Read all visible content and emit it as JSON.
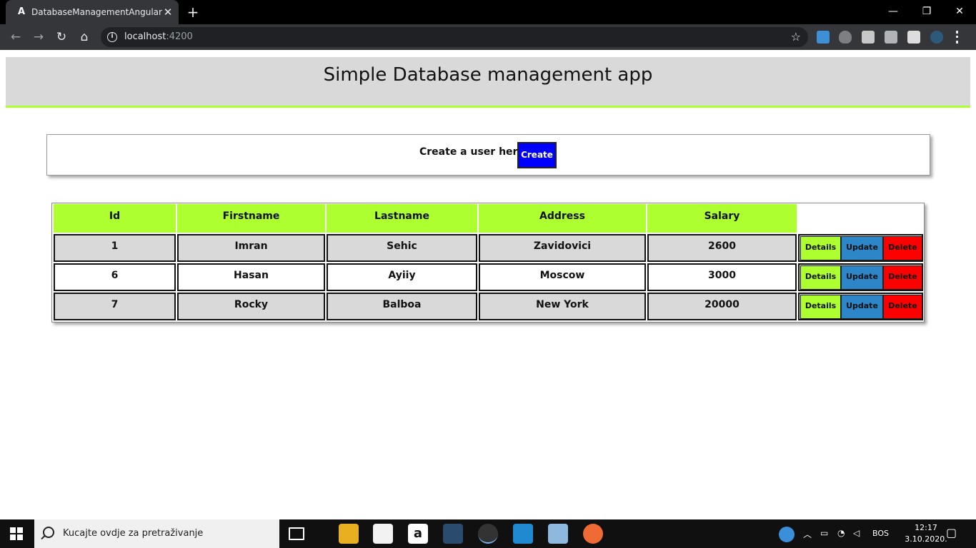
{
  "browser": {
    "tab_title": "DatabaseManagementAngular",
    "tab_icon": "A",
    "close_glyph": "✕",
    "newtab_glyph": "+",
    "url_host": "localhost",
    "url_port": ":4200",
    "window_controls": {
      "minimize": "—",
      "restore": "❐",
      "close": "✕"
    },
    "nav": {
      "back": "←",
      "forward": "→",
      "reload": "↻",
      "home": "⌂"
    },
    "star": "☆"
  },
  "page": {
    "title": "Simple Database management app",
    "create_prompt": "Create a user here!",
    "create_button": "Create"
  },
  "table": {
    "headers": [
      "Id",
      "Firstname",
      "Lastname",
      "Address",
      "Salary"
    ],
    "rows": [
      {
        "id": "1",
        "firstname": "Imran",
        "lastname": "Sehic",
        "address": "Zavidovici",
        "salary": "2600"
      },
      {
        "id": "6",
        "firstname": "Hasan",
        "lastname": "Ayiiy",
        "address": "Moscow",
        "salary": "3000"
      },
      {
        "id": "7",
        "firstname": "Rocky",
        "lastname": "Balboa",
        "address": "New York",
        "salary": "20000"
      }
    ],
    "actions": {
      "details": "Details",
      "update": "Update",
      "delete": "Delete"
    }
  },
  "taskbar": {
    "search_placeholder": "Kucajte ovdje za pretraživanje",
    "language": "BOS",
    "time": "12:17",
    "date": "3.10.2020."
  },
  "colors": {
    "header_bg": "#d9d9d9",
    "accent_green": "#adff2f",
    "create_blue": "#0000ff",
    "update_blue": "#2d86c8",
    "delete_red": "#ff0000"
  }
}
